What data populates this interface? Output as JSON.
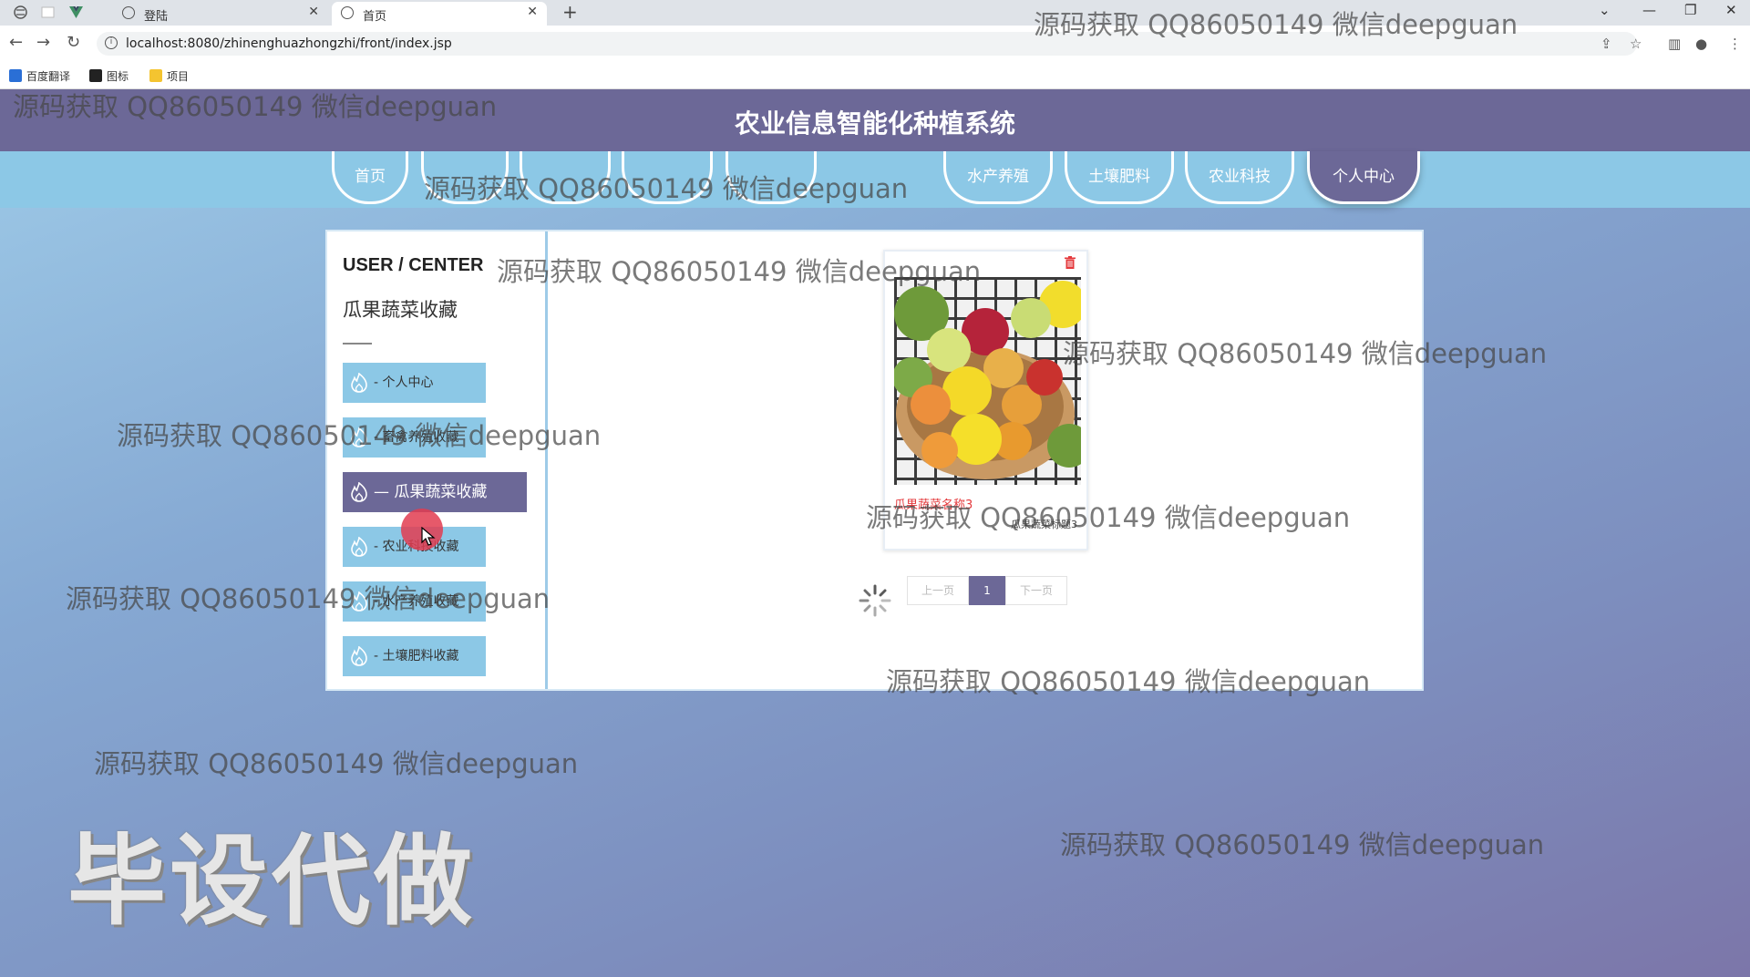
{
  "browser": {
    "tabs": [
      {
        "label": "登陆",
        "active": false
      },
      {
        "label": "首页",
        "active": true
      }
    ],
    "url": "localhost:8080/zhinenghuazhongzhi/front/index.jsp",
    "bookmarks": [
      "百度翻译",
      "图标",
      "项目"
    ]
  },
  "site": {
    "title": "农业信息智能化种植系统",
    "nav": [
      "首页",
      "",
      "",
      "",
      "",
      "水产养殖",
      "土壤肥料",
      "农业科技",
      "个人中心"
    ],
    "nav_active": "个人中心"
  },
  "user_center": {
    "heading": "USER / CENTER",
    "subheading": "瓜果蔬菜收藏",
    "menu": [
      {
        "label": "- 个人中心",
        "active": false
      },
      {
        "label": "- 畜禽养殖收藏",
        "active": false
      },
      {
        "label": "— 瓜果蔬菜收藏",
        "active": true
      },
      {
        "label": "- 农业科技收藏",
        "active": false
      },
      {
        "label": "- 水产养殖收藏",
        "active": false
      },
      {
        "label": "- 土壤肥料收藏",
        "active": false
      }
    ]
  },
  "favorites": [
    {
      "name": "瓜果蔬菜名称3",
      "tag": "瓜果蔬菜标题3"
    }
  ],
  "pagination": {
    "prev": "上一页",
    "current": "1",
    "next": "下一页"
  },
  "watermarks": {
    "text": "源码获取 QQ86050149 微信deepguan",
    "big": "毕设代做"
  },
  "colors": {
    "header": "#6c6897",
    "nav": "#8cc8e6",
    "accent": "#e4393c"
  }
}
